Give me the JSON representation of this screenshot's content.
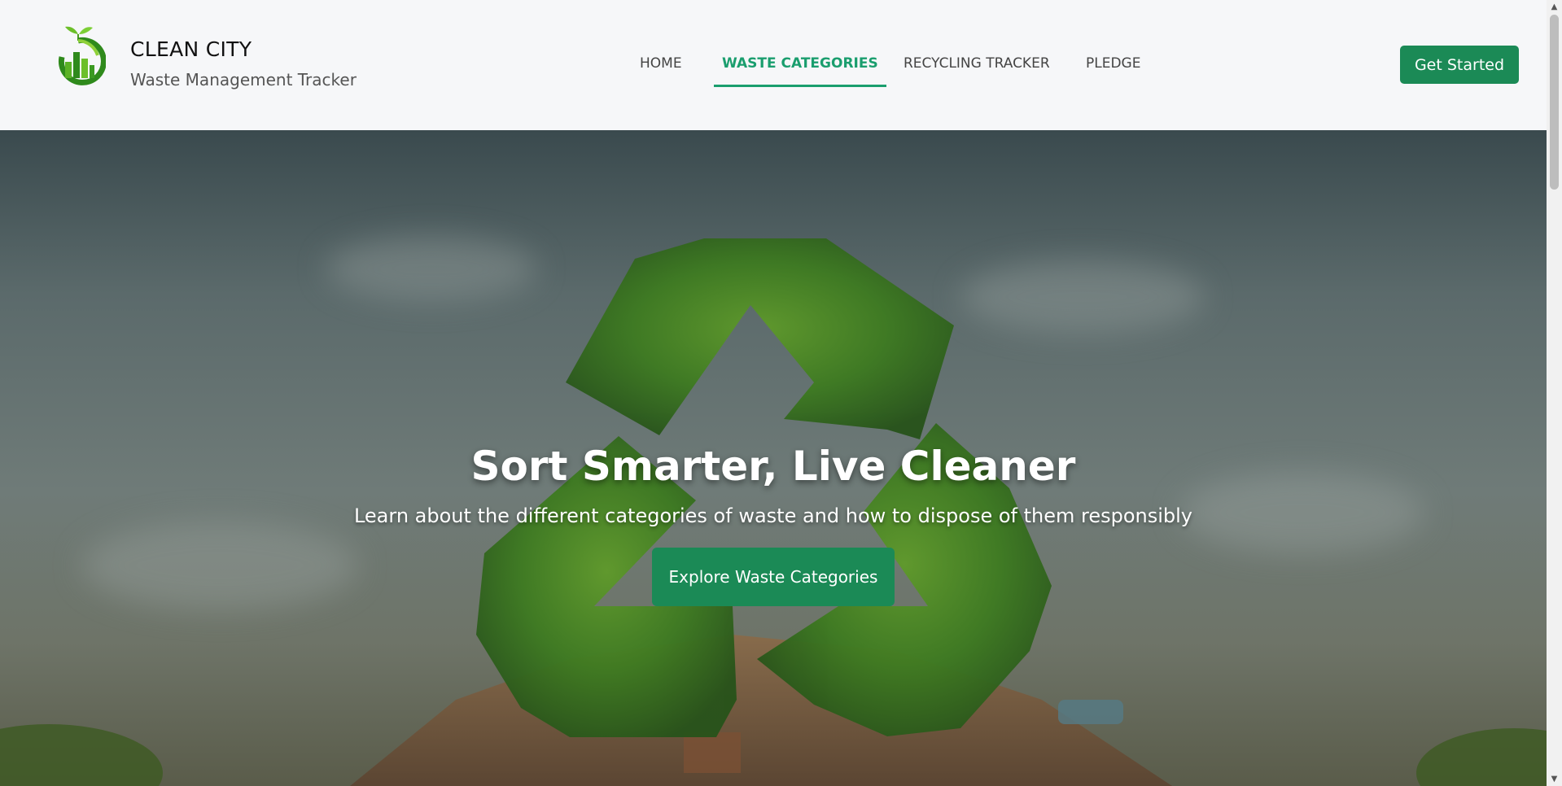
{
  "brand": {
    "title": "CLEAN CITY",
    "subtitle": "Waste Management Tracker",
    "logo_icon": "city-leaf-logo-icon"
  },
  "nav": {
    "items": [
      {
        "label": "HOME",
        "active": false
      },
      {
        "label": "WASTE CATEGORIES",
        "active": true
      },
      {
        "label": "RECYCLING TRACKER",
        "active": false
      },
      {
        "label": "PLEDGE",
        "active": false
      }
    ]
  },
  "header": {
    "cta_label": "Get Started"
  },
  "hero": {
    "title": "Sort Smarter, Live Cleaner",
    "subtitle": "Learn about the different categories of waste and how to dispose of them responsibly",
    "cta_label": "Explore Waste Categories",
    "background_icon": "recycle-symbol-icon"
  },
  "colors": {
    "accent": "#1a9e6e",
    "button": "#1b8a56",
    "header_bg": "#f6f7f9"
  }
}
